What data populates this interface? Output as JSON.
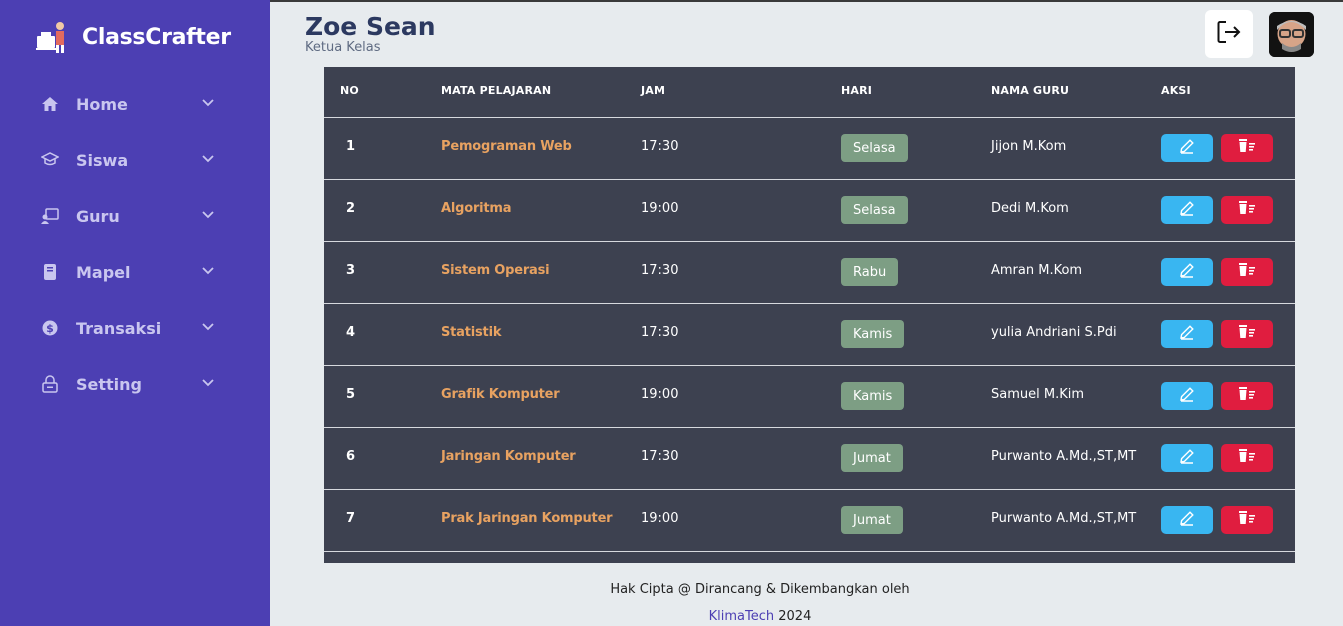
{
  "app": {
    "brand_name": "ClassCrafter",
    "colors": {
      "sidebar": "#4c3fb3",
      "table_bg": "#3d4150",
      "subject_text": "#e8a261",
      "day_badge": "#7d9e84",
      "edit_button": "#39b6f1",
      "delete_button": "#e01d3f"
    }
  },
  "sidebar": {
    "items": [
      {
        "label": "Home",
        "icon": "home-icon"
      },
      {
        "label": "Siswa",
        "icon": "graduation-cap-icon"
      },
      {
        "label": "Guru",
        "icon": "teacher-board-icon"
      },
      {
        "label": "Mapel",
        "icon": "book-icon"
      },
      {
        "label": "Transaksi",
        "icon": "dollar-coin-icon"
      },
      {
        "label": "Setting",
        "icon": "lock-box-icon"
      }
    ]
  },
  "header": {
    "user_name": "Zoe Sean",
    "user_role": "Ketua Kelas",
    "logout_icon": "logout-icon",
    "avatar_icon": "avatar"
  },
  "table": {
    "columns": [
      "NO",
      "MATA PELAJARAN",
      "JAM",
      "HARI",
      "NAMA GURU",
      "AKSI"
    ],
    "rows": [
      {
        "no": "1",
        "subject": "Pemograman Web",
        "time": "17:30",
        "day": "Selasa",
        "teacher": "Jijon M.Kom"
      },
      {
        "no": "2",
        "subject": "Algoritma",
        "time": "19:00",
        "day": "Selasa",
        "teacher": "Dedi M.Kom"
      },
      {
        "no": "3",
        "subject": "Sistem Operasi",
        "time": "17:30",
        "day": "Rabu",
        "teacher": "Amran M.Kom"
      },
      {
        "no": "4",
        "subject": "Statistik",
        "time": "17:30",
        "day": "Kamis",
        "teacher": "yulia Andriani S.Pdi"
      },
      {
        "no": "5",
        "subject": "Grafik Komputer",
        "time": "19:00",
        "day": "Kamis",
        "teacher": "Samuel M.Kim"
      },
      {
        "no": "6",
        "subject": "Jaringan Komputer",
        "time": "17:30",
        "day": "Jumat",
        "teacher": "Purwanto A.Md.,ST,MT"
      },
      {
        "no": "7",
        "subject": "Prak Jaringan Komputer",
        "time": "19:00",
        "day": "Jumat",
        "teacher": "Purwanto A.Md.,ST,MT"
      }
    ]
  },
  "footer": {
    "line1": "Hak Cipta @ Dirancang & Dikembangkan oleh",
    "company": "KlimaTech",
    "year": "2024"
  }
}
